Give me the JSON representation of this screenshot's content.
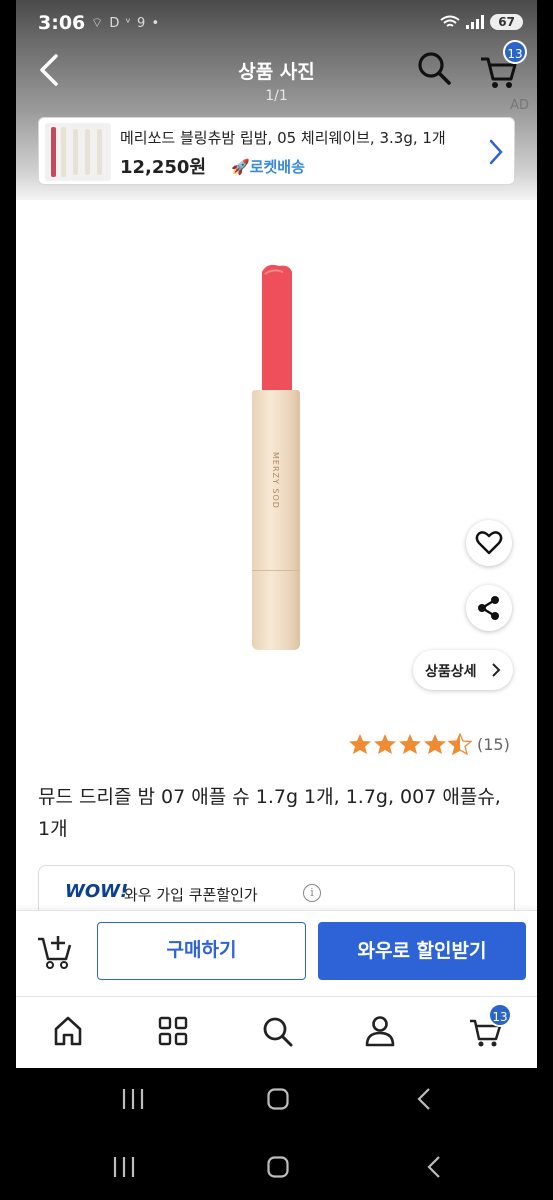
{
  "status_bar": {
    "time": "3:06",
    "left_indicators": "⌔ D ᵛ 9 •",
    "battery": "67"
  },
  "header": {
    "title": "상품 사진",
    "counter": "1/1",
    "cart_count": "13",
    "ad_label": "AD"
  },
  "ad": {
    "product_name": "메리쏘드 블링츄밤 립밤, 05 체리웨이브, 3.3g, 1개",
    "price": "12,250원",
    "delivery": "로켓배송"
  },
  "product": {
    "brand_on_image": "MERZY SOD",
    "detail_button": "상품상세",
    "rating_stars": 4.5,
    "review_count": "(15)",
    "title": "뮤드 드리즐 밤 07 애플 슈 1.7g 1개, 1.7g, 007 애플슈, 1개"
  },
  "coupon": {
    "wow_logo": "WOW!",
    "text": "와우 가입 쿠폰할인가",
    "info": "i"
  },
  "purchase_bar": {
    "buy_label": "구매하기",
    "wow_label": "와우로 할인받기"
  },
  "bottom_nav": {
    "cart_count": "13"
  },
  "colors": {
    "brand_blue": "#2e63d8",
    "star_orange": "#f08a33",
    "rocket_blue": "#3a8ad9",
    "lip_red": "#ef4f5a"
  },
  "icons": [
    "back-arrow-icon",
    "search-icon",
    "cart-icon",
    "heart-icon",
    "share-icon",
    "chevron-right-icon",
    "add-to-cart-icon",
    "home-icon",
    "categories-icon",
    "user-icon",
    "recents-icon",
    "home-circle-icon",
    "system-back-icon"
  ]
}
